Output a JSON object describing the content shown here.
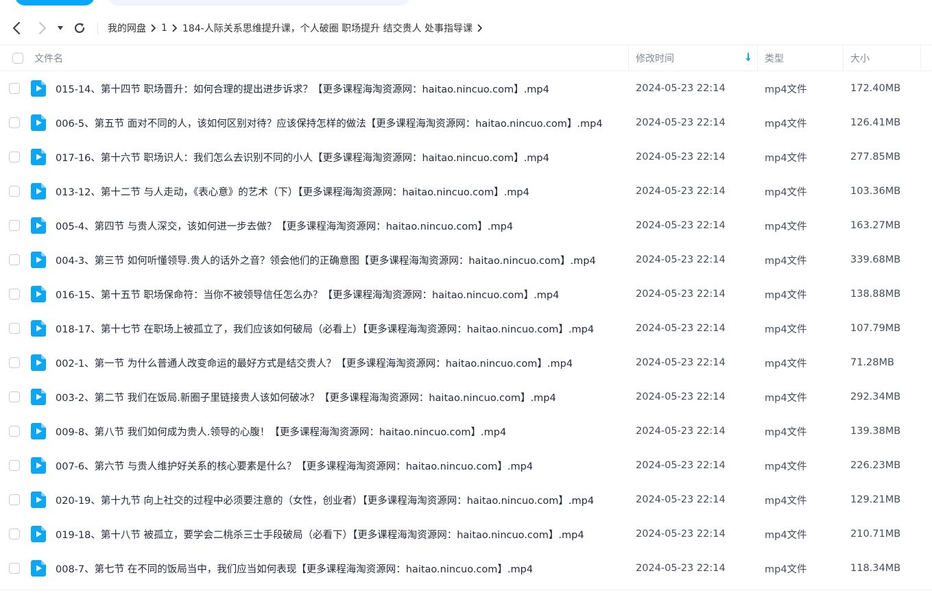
{
  "nav": {
    "breadcrumb": [
      "我的网盘",
      "1",
      "184-人际关系思维提升课，个人破圈 职场提升 结交贵人 处事指导课"
    ]
  },
  "table": {
    "headers": {
      "name": "文件名",
      "time": "修改时间",
      "type": "类型",
      "size": "大小"
    },
    "rows": [
      {
        "name": "015-14、第十四节 职场晋升：如何合理的提出进步诉求？【更多课程海淘资源网：haitao.nincuo.com】.mp4",
        "time": "2024-05-23 22:14",
        "type": "mp4文件",
        "size": "172.40MB"
      },
      {
        "name": "006-5、第五节 面对不同的人，该如何区别对待？应该保持怎样的做法【更多课程海淘资源网：haitao.nincuo.com】.mp4",
        "time": "2024-05-23 22:14",
        "type": "mp4文件",
        "size": "126.41MB"
      },
      {
        "name": "017-16、第十六节 职场识人：我们怎么去识别不同的小人【更多课程海淘资源网：haitao.nincuo.com】.mp4",
        "time": "2024-05-23 22:14",
        "type": "mp4文件",
        "size": "277.85MB"
      },
      {
        "name": "013-12、第十二节 与人走动，《表心意》的艺术（下）【更多课程海淘资源网：haitao.nincuo.com】.mp4",
        "time": "2024-05-23 22:14",
        "type": "mp4文件",
        "size": "103.36MB"
      },
      {
        "name": "005-4、第四节 与贵人深交，该如何进一步去做？【更多课程海淘资源网：haitao.nincuo.com】.mp4",
        "time": "2024-05-23 22:14",
        "type": "mp4文件",
        "size": "163.27MB"
      },
      {
        "name": "004-3、第三节 如何听懂领导.贵人的话外之音？领会他们的正确意图【更多课程海淘资源网：haitao.nincuo.com】.mp4",
        "time": "2024-05-23 22:14",
        "type": "mp4文件",
        "size": "339.68MB"
      },
      {
        "name": "016-15、第十五节 职场保命符：当你不被领导信任怎么办？【更多课程海淘资源网：haitao.nincuo.com】.mp4",
        "time": "2024-05-23 22:14",
        "type": "mp4文件",
        "size": "138.88MB"
      },
      {
        "name": "018-17、第十七节 在职场上被孤立了，我们应该如何破局（必看上）【更多课程海淘资源网：haitao.nincuo.com】.mp4",
        "time": "2024-05-23 22:14",
        "type": "mp4文件",
        "size": "107.79MB"
      },
      {
        "name": "002-1、第一节 为什么普通人改变命运的最好方式是结交贵人？【更多课程海淘资源网：haitao.nincuo.com】.mp4",
        "time": "2024-05-23 22:14",
        "type": "mp4文件",
        "size": "71.28MB"
      },
      {
        "name": "003-2、第二节 我们在饭局.新圈子里链接贵人该如何破冰？【更多课程海淘资源网：haitao.nincuo.com】.mp4",
        "time": "2024-05-23 22:14",
        "type": "mp4文件",
        "size": "292.34MB"
      },
      {
        "name": "009-8、第八节 我们如何成为贵人.领导的心腹！【更多课程海淘资源网：haitao.nincuo.com】.mp4",
        "time": "2024-05-23 22:14",
        "type": "mp4文件",
        "size": "139.38MB"
      },
      {
        "name": "007-6、第六节 与贵人维护好关系的核心要素是什么？【更多课程海淘资源网：haitao.nincuo.com】.mp4",
        "time": "2024-05-23 22:14",
        "type": "mp4文件",
        "size": "226.23MB"
      },
      {
        "name": "020-19、第十九节 向上社交的过程中必须要注意的（女性，创业者）【更多课程海淘资源网：haitao.nincuo.com】.mp4",
        "time": "2024-05-23 22:14",
        "type": "mp4文件",
        "size": "129.21MB"
      },
      {
        "name": "019-18、第十八节 被孤立，要学会二桃杀三士手段破局（必看下）【更多课程海淘资源网：haitao.nincuo.com】.mp4",
        "time": "2024-05-23 22:14",
        "type": "mp4文件",
        "size": "210.71MB"
      },
      {
        "name": "008-7、第七节 在不同的饭局当中，我们应当如何表现【更多课程海淘资源网：haitao.nincuo.com】.mp4",
        "time": "2024-05-23 22:14",
        "type": "mp4文件",
        "size": "118.34MB"
      }
    ]
  },
  "icons": {
    "back": "chevron-left-icon",
    "forward": "chevron-right-icon",
    "dropdown": "caret-down-icon",
    "refresh": "refresh-icon",
    "sort": "sort-down-arrow-icon",
    "file": "video-file-icon"
  },
  "colors": {
    "accent": "#06a7ff",
    "file_icon": "#0ba7f5",
    "sort_arrow": "#06a7ff"
  }
}
